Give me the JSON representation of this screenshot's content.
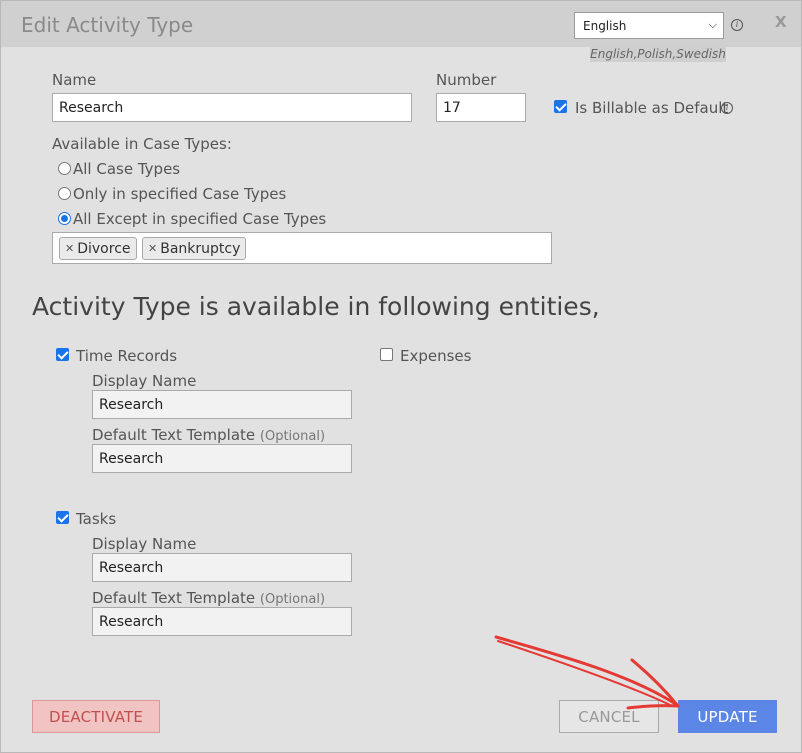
{
  "dialog": {
    "title": "Edit Activity Type",
    "close_label": "X",
    "language": {
      "selected": "English",
      "hint": "English,Polish,Swedish"
    }
  },
  "form": {
    "name_label": "Name",
    "name_value": "Research",
    "number_label": "Number",
    "number_value": "17",
    "billable_label": "Is Billable as Default",
    "billable_checked": true,
    "case_types_label": "Available in Case Types:",
    "case_type_options": [
      "All Case Types",
      "Only in specified Case Types",
      "All Except in specified Case Types"
    ],
    "case_type_selected": "All Except in specified Case Types",
    "case_tags": [
      "Divorce",
      "Bankruptcy"
    ]
  },
  "entities": {
    "heading": "Activity Type is available in following entities,",
    "time_records": {
      "label": "Time Records",
      "checked": true,
      "display_name_label": "Display Name",
      "display_name_value": "Research",
      "template_label": "Default Text Template",
      "optional_label": "(Optional)",
      "template_value": "Research"
    },
    "expenses": {
      "label": "Expenses",
      "checked": false
    },
    "tasks": {
      "label": "Tasks",
      "checked": true,
      "display_name_label": "Display Name",
      "display_name_value": "Research",
      "template_label": "Default Text Template",
      "optional_label": "(Optional)",
      "template_value": "Research"
    }
  },
  "buttons": {
    "deactivate": "DEACTIVATE",
    "cancel": "CANCEL",
    "update": "UPDATE"
  },
  "colors": {
    "primary": "#5b86e5",
    "danger_bg": "#f2c3c3",
    "danger_text": "#c0504d",
    "checkbox": "#1a73e8",
    "annotation_arrow": "#e53935"
  }
}
